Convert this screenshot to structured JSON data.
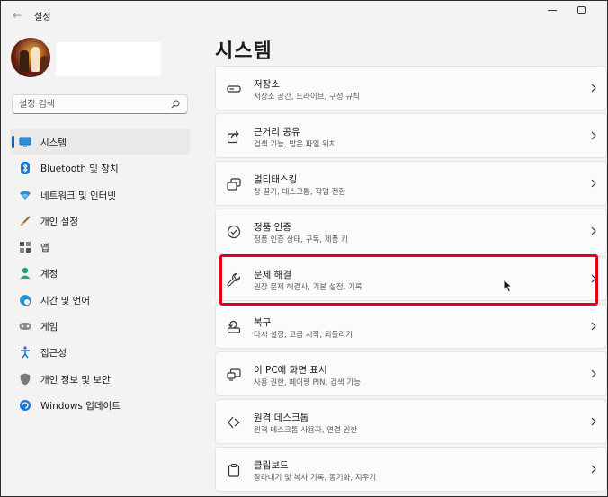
{
  "window": {
    "title": "설정"
  },
  "search": {
    "placeholder": "설정 검색"
  },
  "page": {
    "title": "시스템"
  },
  "sidebar": {
    "items": [
      {
        "label": "시스템",
        "icon": "monitor-icon",
        "active": true
      },
      {
        "label": "Bluetooth 및 장치",
        "icon": "bluetooth-icon"
      },
      {
        "label": "네트워크 및 인터넷",
        "icon": "wifi-icon"
      },
      {
        "label": "개인 설정",
        "icon": "brush-icon"
      },
      {
        "label": "앱",
        "icon": "apps-icon"
      },
      {
        "label": "계정",
        "icon": "person-icon"
      },
      {
        "label": "시간 및 언어",
        "icon": "globe-clock-icon"
      },
      {
        "label": "게임",
        "icon": "gamepad-icon"
      },
      {
        "label": "접근성",
        "icon": "accessibility-icon"
      },
      {
        "label": "개인 정보 및 보안",
        "icon": "shield-icon"
      },
      {
        "label": "Windows 업데이트",
        "icon": "update-icon"
      }
    ]
  },
  "cards": [
    {
      "title": "저장소",
      "subtitle": "저장소 공간, 드라이브, 구성 규칙",
      "icon": "storage-icon"
    },
    {
      "title": "근거리 공유",
      "subtitle": "검색 기능, 받은 파일 위치",
      "icon": "share-icon"
    },
    {
      "title": "멀티태스킹",
      "subtitle": "창 끌기, 데스크톱, 작업 전환",
      "icon": "multitask-icon"
    },
    {
      "title": "정품 인증",
      "subtitle": "정품 인증 상태, 구독, 제품 키",
      "icon": "check-circle-icon"
    },
    {
      "title": "문제 해결",
      "subtitle": "권장 문제 해결사, 기본 설정, 기록",
      "icon": "wrench-icon"
    },
    {
      "title": "복구",
      "subtitle": "다시 설정, 고급 시작, 되돌리기",
      "icon": "recovery-icon"
    },
    {
      "title": "이 PC에 화면 표시",
      "subtitle": "사용 권한, 페어링 PIN, 검색 기능",
      "icon": "project-icon"
    },
    {
      "title": "원격 데스크톱",
      "subtitle": "원격 데스크톱 사용자, 연결 권한",
      "icon": "remote-icon"
    },
    {
      "title": "클립보드",
      "subtitle": "잘라내기 및 복사 기록, 동기화, 지우기",
      "icon": "clipboard-icon"
    }
  ],
  "colors": {
    "accent": "#0067c0",
    "highlight": "#e0001b"
  }
}
